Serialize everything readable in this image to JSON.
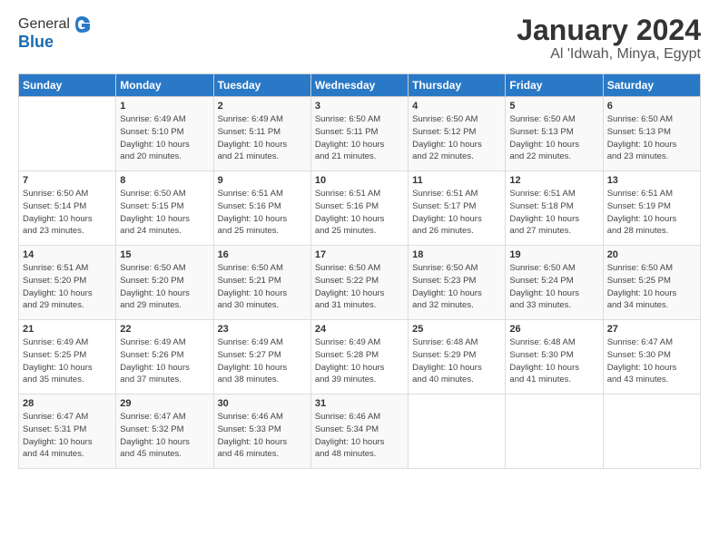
{
  "header": {
    "logo_line1": "General",
    "logo_line2": "Blue",
    "month": "January 2024",
    "location": "Al 'Idwah, Minya, Egypt"
  },
  "weekdays": [
    "Sunday",
    "Monday",
    "Tuesday",
    "Wednesday",
    "Thursday",
    "Friday",
    "Saturday"
  ],
  "weeks": [
    [
      {
        "num": "",
        "info": ""
      },
      {
        "num": "1",
        "info": "Sunrise: 6:49 AM\nSunset: 5:10 PM\nDaylight: 10 hours\nand 20 minutes."
      },
      {
        "num": "2",
        "info": "Sunrise: 6:49 AM\nSunset: 5:11 PM\nDaylight: 10 hours\nand 21 minutes."
      },
      {
        "num": "3",
        "info": "Sunrise: 6:50 AM\nSunset: 5:11 PM\nDaylight: 10 hours\nand 21 minutes."
      },
      {
        "num": "4",
        "info": "Sunrise: 6:50 AM\nSunset: 5:12 PM\nDaylight: 10 hours\nand 22 minutes."
      },
      {
        "num": "5",
        "info": "Sunrise: 6:50 AM\nSunset: 5:13 PM\nDaylight: 10 hours\nand 22 minutes."
      },
      {
        "num": "6",
        "info": "Sunrise: 6:50 AM\nSunset: 5:13 PM\nDaylight: 10 hours\nand 23 minutes."
      }
    ],
    [
      {
        "num": "7",
        "info": "Sunrise: 6:50 AM\nSunset: 5:14 PM\nDaylight: 10 hours\nand 23 minutes."
      },
      {
        "num": "8",
        "info": "Sunrise: 6:50 AM\nSunset: 5:15 PM\nDaylight: 10 hours\nand 24 minutes."
      },
      {
        "num": "9",
        "info": "Sunrise: 6:51 AM\nSunset: 5:16 PM\nDaylight: 10 hours\nand 25 minutes."
      },
      {
        "num": "10",
        "info": "Sunrise: 6:51 AM\nSunset: 5:16 PM\nDaylight: 10 hours\nand 25 minutes."
      },
      {
        "num": "11",
        "info": "Sunrise: 6:51 AM\nSunset: 5:17 PM\nDaylight: 10 hours\nand 26 minutes."
      },
      {
        "num": "12",
        "info": "Sunrise: 6:51 AM\nSunset: 5:18 PM\nDaylight: 10 hours\nand 27 minutes."
      },
      {
        "num": "13",
        "info": "Sunrise: 6:51 AM\nSunset: 5:19 PM\nDaylight: 10 hours\nand 28 minutes."
      }
    ],
    [
      {
        "num": "14",
        "info": "Sunrise: 6:51 AM\nSunset: 5:20 PM\nDaylight: 10 hours\nand 29 minutes."
      },
      {
        "num": "15",
        "info": "Sunrise: 6:50 AM\nSunset: 5:20 PM\nDaylight: 10 hours\nand 29 minutes."
      },
      {
        "num": "16",
        "info": "Sunrise: 6:50 AM\nSunset: 5:21 PM\nDaylight: 10 hours\nand 30 minutes."
      },
      {
        "num": "17",
        "info": "Sunrise: 6:50 AM\nSunset: 5:22 PM\nDaylight: 10 hours\nand 31 minutes."
      },
      {
        "num": "18",
        "info": "Sunrise: 6:50 AM\nSunset: 5:23 PM\nDaylight: 10 hours\nand 32 minutes."
      },
      {
        "num": "19",
        "info": "Sunrise: 6:50 AM\nSunset: 5:24 PM\nDaylight: 10 hours\nand 33 minutes."
      },
      {
        "num": "20",
        "info": "Sunrise: 6:50 AM\nSunset: 5:25 PM\nDaylight: 10 hours\nand 34 minutes."
      }
    ],
    [
      {
        "num": "21",
        "info": "Sunrise: 6:49 AM\nSunset: 5:25 PM\nDaylight: 10 hours\nand 35 minutes."
      },
      {
        "num": "22",
        "info": "Sunrise: 6:49 AM\nSunset: 5:26 PM\nDaylight: 10 hours\nand 37 minutes."
      },
      {
        "num": "23",
        "info": "Sunrise: 6:49 AM\nSunset: 5:27 PM\nDaylight: 10 hours\nand 38 minutes."
      },
      {
        "num": "24",
        "info": "Sunrise: 6:49 AM\nSunset: 5:28 PM\nDaylight: 10 hours\nand 39 minutes."
      },
      {
        "num": "25",
        "info": "Sunrise: 6:48 AM\nSunset: 5:29 PM\nDaylight: 10 hours\nand 40 minutes."
      },
      {
        "num": "26",
        "info": "Sunrise: 6:48 AM\nSunset: 5:30 PM\nDaylight: 10 hours\nand 41 minutes."
      },
      {
        "num": "27",
        "info": "Sunrise: 6:47 AM\nSunset: 5:30 PM\nDaylight: 10 hours\nand 43 minutes."
      }
    ],
    [
      {
        "num": "28",
        "info": "Sunrise: 6:47 AM\nSunset: 5:31 PM\nDaylight: 10 hours\nand 44 minutes."
      },
      {
        "num": "29",
        "info": "Sunrise: 6:47 AM\nSunset: 5:32 PM\nDaylight: 10 hours\nand 45 minutes."
      },
      {
        "num": "30",
        "info": "Sunrise: 6:46 AM\nSunset: 5:33 PM\nDaylight: 10 hours\nand 46 minutes."
      },
      {
        "num": "31",
        "info": "Sunrise: 6:46 AM\nSunset: 5:34 PM\nDaylight: 10 hours\nand 48 minutes."
      },
      {
        "num": "",
        "info": ""
      },
      {
        "num": "",
        "info": ""
      },
      {
        "num": "",
        "info": ""
      }
    ]
  ]
}
